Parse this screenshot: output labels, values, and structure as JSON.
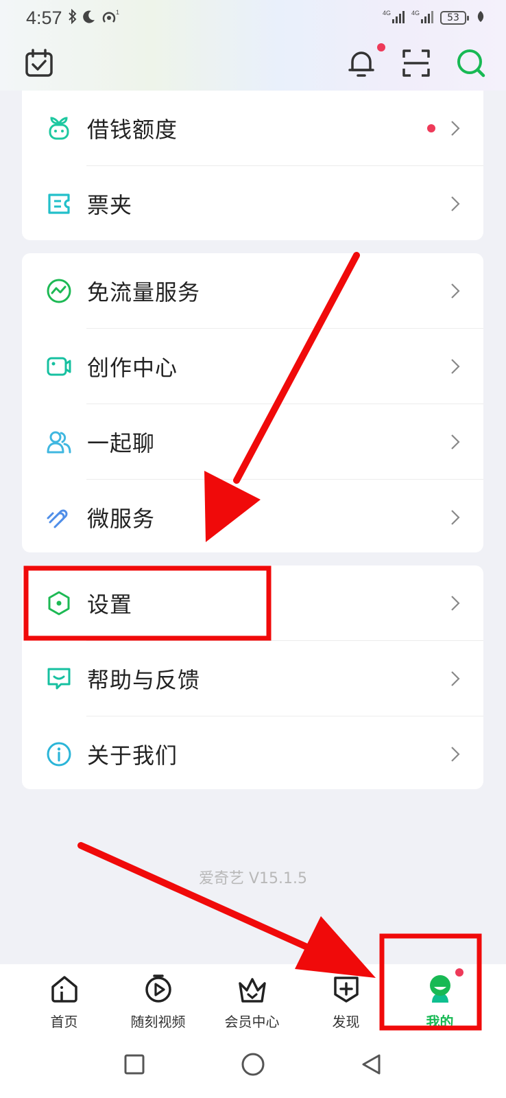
{
  "status_bar": {
    "time": "4:57",
    "battery": "53",
    "signal_label_1": "4G",
    "signal_label_2": "4G"
  },
  "header": {
    "icons": [
      "calendar-check-icon",
      "bell-icon",
      "scan-icon",
      "search-icon"
    ]
  },
  "menu_group_1": {
    "items": [
      {
        "label": "借钱额度",
        "icon": "sprout-icon",
        "has_dot": true
      },
      {
        "label": "票夹",
        "icon": "ticket-icon",
        "has_dot": false
      }
    ]
  },
  "menu_group_2": {
    "items": [
      {
        "label": "免流量服务",
        "icon": "wave-icon"
      },
      {
        "label": "创作中心",
        "icon": "camera-icon"
      },
      {
        "label": "一起聊",
        "icon": "users-icon"
      },
      {
        "label": "微服务",
        "icon": "link-icon"
      }
    ]
  },
  "menu_group_3": {
    "items": [
      {
        "label": "设置",
        "icon": "hexagon-settings-icon"
      },
      {
        "label": "帮助与反馈",
        "icon": "chat-icon"
      },
      {
        "label": "关于我们",
        "icon": "info-icon"
      }
    ]
  },
  "version": "爱奇艺 V15.1.5",
  "tabbar": {
    "tabs": [
      {
        "label": "首页",
        "icon": "home-icon"
      },
      {
        "label": "随刻视频",
        "icon": "play-circle-icon"
      },
      {
        "label": "会员中心",
        "icon": "crown-icon"
      },
      {
        "label": "发现",
        "icon": "discover-icon"
      },
      {
        "label": "我的",
        "icon": "profile-icon",
        "active": true
      }
    ]
  },
  "colors": {
    "accent_green": "#18b954",
    "annotation_red": "#f00a0a",
    "dot_red": "#ee3a59"
  }
}
